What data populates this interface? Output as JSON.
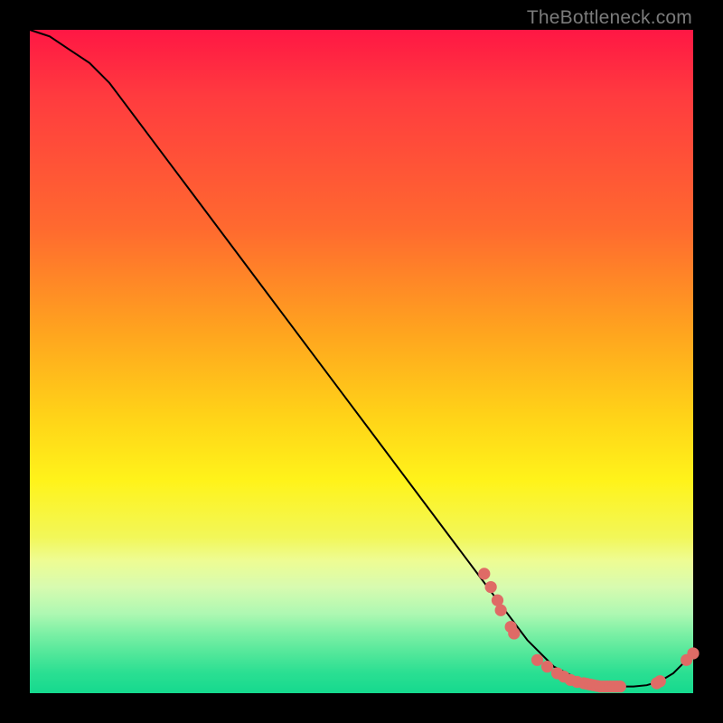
{
  "watermark": "TheBottleneck.com",
  "colors": {
    "dot": "#df6b66",
    "curve": "#000000",
    "frame": "#000000"
  },
  "chart_data": {
    "type": "line",
    "title": "",
    "xlabel": "",
    "ylabel": "",
    "xlim": [
      0,
      100
    ],
    "ylim": [
      0,
      100
    ],
    "grid": false,
    "legend": false,
    "series": [
      {
        "name": "curve",
        "x": [
          0,
          3,
          6,
          9,
          12,
          15,
          18,
          21,
          24,
          27,
          30,
          33,
          36,
          39,
          42,
          45,
          48,
          51,
          54,
          57,
          60,
          63,
          66,
          69,
          72,
          75,
          77,
          79,
          81,
          83,
          85,
          87,
          89,
          91,
          93,
          95,
          97,
          99,
          100
        ],
        "y": [
          100,
          99,
          97,
          95,
          92,
          88,
          84,
          80,
          76,
          72,
          68,
          64,
          60,
          56,
          52,
          48,
          44,
          40,
          36,
          32,
          28,
          24,
          20,
          16,
          12,
          8,
          6,
          4,
          3,
          2,
          1.5,
          1.2,
          1.0,
          1.0,
          1.2,
          1.8,
          3.0,
          5.0,
          6.0
        ]
      }
    ],
    "scatter": [
      {
        "x": 68.5,
        "y": 18.0
      },
      {
        "x": 69.5,
        "y": 16.0
      },
      {
        "x": 70.5,
        "y": 14.0
      },
      {
        "x": 71.0,
        "y": 12.5
      },
      {
        "x": 72.5,
        "y": 10.0
      },
      {
        "x": 73.0,
        "y": 9.0
      },
      {
        "x": 76.5,
        "y": 5.0
      },
      {
        "x": 78.0,
        "y": 4.0
      },
      {
        "x": 79.5,
        "y": 3.0
      },
      {
        "x": 80.5,
        "y": 2.5
      },
      {
        "x": 81.5,
        "y": 2.0
      },
      {
        "x": 82.5,
        "y": 1.7
      },
      {
        "x": 83.5,
        "y": 1.5
      },
      {
        "x": 84.0,
        "y": 1.4
      },
      {
        "x": 84.5,
        "y": 1.3
      },
      {
        "x": 85.0,
        "y": 1.2
      },
      {
        "x": 85.5,
        "y": 1.1
      },
      {
        "x": 86.0,
        "y": 1.0
      },
      {
        "x": 86.5,
        "y": 1.0
      },
      {
        "x": 87.0,
        "y": 1.0
      },
      {
        "x": 87.5,
        "y": 1.0
      },
      {
        "x": 88.0,
        "y": 1.0
      },
      {
        "x": 88.5,
        "y": 1.0
      },
      {
        "x": 89.0,
        "y": 1.0
      },
      {
        "x": 94.5,
        "y": 1.5
      },
      {
        "x": 95.0,
        "y": 1.8
      },
      {
        "x": 99.0,
        "y": 5.0
      },
      {
        "x": 100.0,
        "y": 6.0
      }
    ],
    "dot_radius_data_units": 0.9
  }
}
